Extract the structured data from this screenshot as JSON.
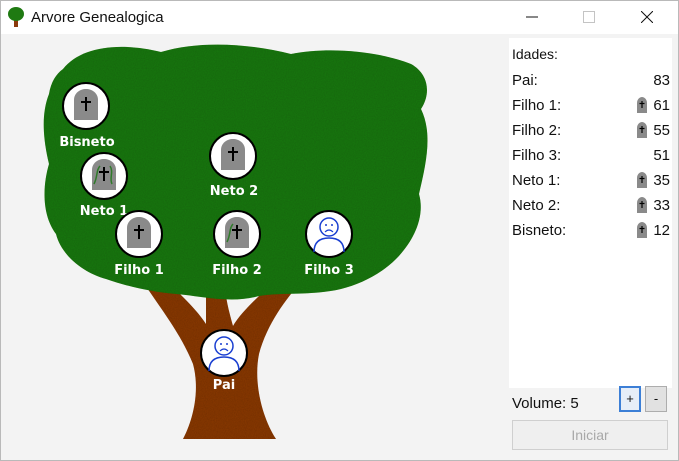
{
  "window": {
    "title": "Arvore Genealogica",
    "app_icon": "tree-icon",
    "controls": [
      "minimize-icon",
      "maximize-icon",
      "close-icon"
    ]
  },
  "tree": {
    "people": [
      {
        "label": "Bisneto",
        "state": "deceased"
      },
      {
        "label": "Neto 1",
        "state": "deceased"
      },
      {
        "label": "Neto 2",
        "state": "deceased"
      },
      {
        "label": "Filho 1",
        "state": "deceased"
      },
      {
        "label": "Filho 2",
        "state": "deceased"
      },
      {
        "label": "Filho 3",
        "state": "alive"
      },
      {
        "label": "Pai",
        "state": "alive"
      }
    ],
    "colors": {
      "leaves": "#1f7a12",
      "trunk": "#8b3a0c",
      "alive_face": "#1a3fd1",
      "tombstone": "#8a8a8a"
    }
  },
  "panel": {
    "ages_title": "Idades:",
    "ages": [
      {
        "name": "Pai:",
        "value": "83",
        "deceased": false
      },
      {
        "name": "Filho 1:",
        "value": "61",
        "deceased": true
      },
      {
        "name": "Filho 2:",
        "value": "55",
        "deceased": true
      },
      {
        "name": "Filho 3:",
        "value": "51",
        "deceased": false
      },
      {
        "name": "Neto 1:",
        "value": "35",
        "deceased": true
      },
      {
        "name": "Neto 2:",
        "value": "33",
        "deceased": true
      },
      {
        "name": "Bisneto:",
        "value": "12",
        "deceased": true
      }
    ],
    "volume_label": "Volume: 5",
    "plus_label": "+",
    "minus_label": "-",
    "start_label": "Iniciar"
  }
}
